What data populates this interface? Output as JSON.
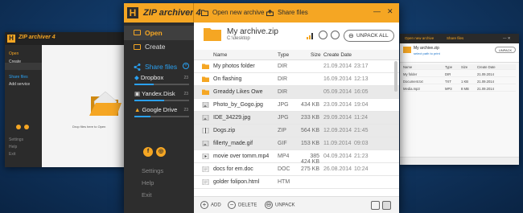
{
  "background_color": "#123a68",
  "accent_color": "#f5a623",
  "app": {
    "title": "ZIP archiver 4",
    "logo_letter": "H"
  },
  "topbar": {
    "open_new_archive": "Open new archive",
    "share_files": "Share files"
  },
  "sidebar": {
    "open": "Open",
    "create": "Create",
    "share_files": "Share files",
    "services": [
      {
        "name": "Dropbox",
        "number": "23",
        "usage": 0.35
      },
      {
        "name": "Yandex.Disk",
        "number": "23",
        "usage": 0.55
      },
      {
        "name": "Google Drive",
        "number": "23",
        "usage": 0.3
      }
    ],
    "settings": "Settings",
    "help": "Help",
    "exit": "Exit"
  },
  "header": {
    "archive_name": "My archive.zip",
    "archive_path": "C:\\desktop",
    "unpack_all": "UNPACK ALL"
  },
  "columns": {
    "name": "Name",
    "type": "Type",
    "size": "Size",
    "create_date": "Create Date"
  },
  "files": [
    {
      "name": "My photos folder",
      "type": "DIR",
      "size": "",
      "date": "21.09.2014",
      "time": "23:17",
      "icon": "folder-icon",
      "selected": false
    },
    {
      "name": "On flashing",
      "type": "DIR",
      "size": "",
      "date": "16.09.2014",
      "time": "12:13",
      "icon": "folder-icon",
      "selected": false
    },
    {
      "name": "Greaddy Likes Owe",
      "type": "DIR",
      "size": "",
      "date": "05.09.2014",
      "time": "16:05",
      "icon": "folder-icon",
      "selected": true
    },
    {
      "name": "Photo_by_Gogo.jpg",
      "type": "JPG",
      "size": "434 KB",
      "date": "23.09.2014",
      "time": "19:04",
      "icon": "image-file-icon",
      "selected": false
    },
    {
      "name": "IDE_34229.jpg",
      "type": "JPG",
      "size": "233 KB",
      "date": "29.09.2014",
      "time": "11:24",
      "icon": "image-file-icon",
      "selected": true
    },
    {
      "name": "Dogs.zip",
      "type": "ZIP",
      "size": "564 KB",
      "date": "12.09.2014",
      "time": "21:45",
      "icon": "zip-file-icon",
      "selected": true
    },
    {
      "name": "fillerty_made.gif",
      "type": "GIF",
      "size": "153 KB",
      "date": "11.09.2014",
      "time": "09:03",
      "icon": "image-file-icon",
      "selected": true
    },
    {
      "name": "movie over tomm.mp4",
      "type": "MP4",
      "size": "385 424 KB",
      "date": "04.09.2014",
      "time": "21:23",
      "icon": "video-file-icon",
      "selected": false
    },
    {
      "name": "docs for em.doc",
      "type": "DOC",
      "size": "275 KB",
      "date": "26.08.2014",
      "time": "10:24",
      "icon": "document-file-icon",
      "selected": false
    },
    {
      "name": "golder folipon.html",
      "type": "HTM",
      "size": "",
      "date": "",
      "time": "",
      "icon": "document-file-icon",
      "selected": false
    }
  ],
  "bottombar": {
    "add": "ADD",
    "delete": "DELETE",
    "unpack": "UNPACK"
  },
  "backdrop_left": {
    "title": "ZIP archiver 4",
    "open": "Open",
    "create": "Create",
    "share_files": "Share files",
    "add_service": "Add service",
    "drop_hint": "Drop files here to Open",
    "settings": "Settings",
    "help": "Help",
    "exit": "Exit"
  },
  "backdrop_right": {
    "open_new_archive": "Open new archive",
    "share_files": "Share files",
    "archive_name": "My archive.zip",
    "link": "select path to print",
    "unpack": "UNPACK",
    "columns": {
      "name": "Name",
      "type": "Type",
      "size": "Size",
      "create_date": "Create Date"
    },
    "rows": [
      {
        "name": "My folder",
        "type": "DIR",
        "size": "",
        "date": "21.09.2014"
      },
      {
        "name": "Document.txt",
        "type": "TXT",
        "size": "1 KB",
        "date": "21.09.2014"
      },
      {
        "name": "Media.mp3",
        "type": "MP3",
        "size": "8 MB",
        "date": "21.09.2014"
      }
    ]
  }
}
